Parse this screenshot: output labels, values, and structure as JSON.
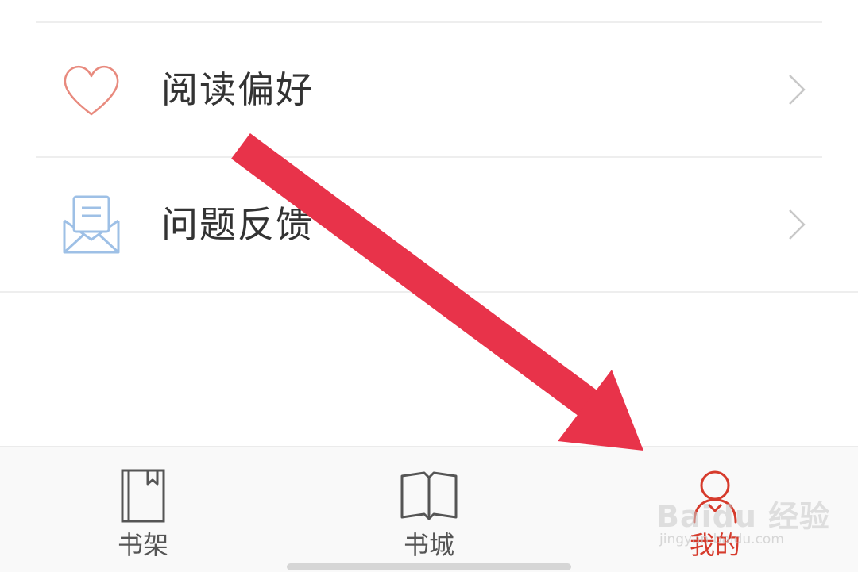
{
  "menu": {
    "items": [
      {
        "label": "阅读偏好",
        "icon": "heart-icon",
        "icon_color": "#e88a7e"
      },
      {
        "label": "问题反馈",
        "icon": "envelope-icon",
        "icon_color": "#9ec0e6"
      }
    ]
  },
  "tabbar": {
    "tabs": [
      {
        "label": "书架",
        "icon": "bookshelf-icon",
        "active": false
      },
      {
        "label": "书城",
        "icon": "open-book-icon",
        "active": false
      },
      {
        "label": "我的",
        "icon": "profile-icon",
        "active": true
      }
    ],
    "active_color": "#d63b2c",
    "inactive_color": "#555555"
  },
  "annotation": {
    "type": "arrow",
    "color": "#e8334a",
    "points_to": "我的"
  },
  "watermark": {
    "brand": "Baidu 经验",
    "url": "jingyan.baidu.com"
  }
}
